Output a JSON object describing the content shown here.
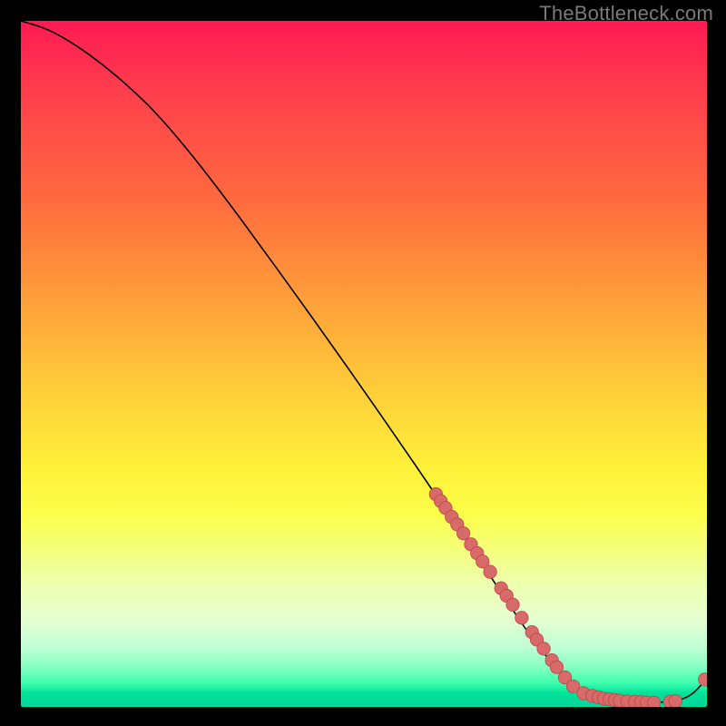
{
  "watermark": "TheBottleneck.com",
  "chart_data": {
    "type": "line",
    "title": "",
    "xlabel": "",
    "ylabel": "",
    "xlim": [
      0,
      100
    ],
    "ylim": [
      0,
      100
    ],
    "series": [
      {
        "name": "curve",
        "x": [
          0,
          4,
          8,
          12,
          16,
          20,
          25,
          30,
          35,
          40,
          45,
          50,
          55,
          60,
          65,
          70,
          75,
          80,
          83,
          86,
          89,
          92,
          95,
          97,
          98.5,
          100
        ],
        "y": [
          100,
          98.8,
          96.5,
          93.6,
          90.2,
          86.3,
          80.4,
          73.9,
          67.1,
          60.2,
          53.2,
          46.1,
          38.9,
          31.6,
          24.2,
          16.7,
          9.2,
          3.4,
          1.8,
          1.0,
          0.7,
          0.6,
          0.8,
          1.3,
          2.4,
          4.2
        ]
      }
    ],
    "markers": [
      {
        "x": 60.5,
        "y": 31.0
      },
      {
        "x": 61.2,
        "y": 30.0
      },
      {
        "x": 61.9,
        "y": 29.0
      },
      {
        "x": 62.8,
        "y": 27.7
      },
      {
        "x": 63.6,
        "y": 26.6
      },
      {
        "x": 64.5,
        "y": 25.3
      },
      {
        "x": 65.6,
        "y": 23.7
      },
      {
        "x": 66.5,
        "y": 22.4
      },
      {
        "x": 67.3,
        "y": 21.2
      },
      {
        "x": 68.4,
        "y": 19.7
      },
      {
        "x": 70.0,
        "y": 17.3
      },
      {
        "x": 70.8,
        "y": 16.2
      },
      {
        "x": 71.7,
        "y": 14.9
      },
      {
        "x": 73.0,
        "y": 13.0
      },
      {
        "x": 74.5,
        "y": 10.9
      },
      {
        "x": 75.2,
        "y": 9.8
      },
      {
        "x": 76.2,
        "y": 8.5
      },
      {
        "x": 77.4,
        "y": 6.8
      },
      {
        "x": 78.1,
        "y": 5.8
      },
      {
        "x": 79.3,
        "y": 4.3
      },
      {
        "x": 80.5,
        "y": 3.0
      },
      {
        "x": 82.0,
        "y": 2.0
      },
      {
        "x": 83.3,
        "y": 1.6
      },
      {
        "x": 84.2,
        "y": 1.4
      },
      {
        "x": 85.0,
        "y": 1.2
      },
      {
        "x": 85.8,
        "y": 1.1
      },
      {
        "x": 86.6,
        "y": 1.0
      },
      {
        "x": 87.3,
        "y": 0.9
      },
      {
        "x": 88.4,
        "y": 0.8
      },
      {
        "x": 89.5,
        "y": 0.75
      },
      {
        "x": 90.4,
        "y": 0.7
      },
      {
        "x": 91.2,
        "y": 0.65
      },
      {
        "x": 92.3,
        "y": 0.6
      },
      {
        "x": 94.6,
        "y": 0.75
      },
      {
        "x": 95.4,
        "y": 0.85
      },
      {
        "x": 99.7,
        "y": 4.0
      }
    ],
    "colors": {
      "curve": "#000000",
      "marker_fill": "#d86a6a",
      "marker_stroke": "#bb4747"
    }
  }
}
